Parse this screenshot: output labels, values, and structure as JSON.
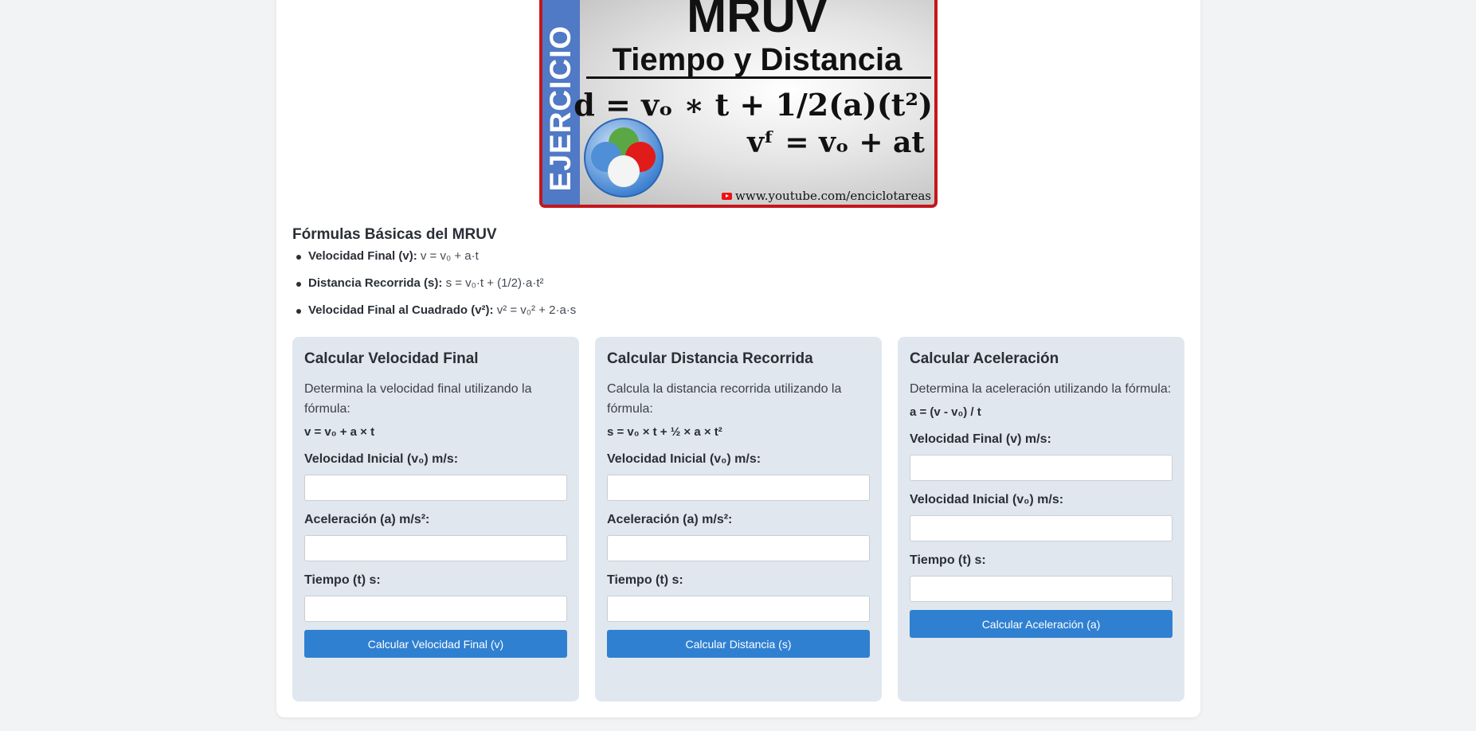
{
  "banner": {
    "side_text": "EJERCICIO",
    "title": "MRUV",
    "subtitle": "Tiempo y Distancia",
    "formula1": "d = vₒ ∗ t + 1/2(a)(t²)",
    "formula2": "vᶠ = vₒ + at",
    "url": "www.youtube.com/enciclotareas",
    "border_color": "#c4161c",
    "side_color": "#5079c6"
  },
  "formulas": {
    "title": "Fórmulas Básicas del MRUV",
    "items": [
      {
        "label": "Velocidad Final (v):",
        "formula": "v = v₀ + a·t"
      },
      {
        "label": "Distancia Recorrida (s):",
        "formula": "s = v₀·t + (1/2)·a·t²"
      },
      {
        "label": "Velocidad Final al Cuadrado (v²):",
        "formula": "v² = v₀² + 2·a·s"
      }
    ]
  },
  "calculators": {
    "velocity": {
      "title": "Calcular Velocidad Final",
      "description": "Determina la velocidad final utilizando la fórmula:",
      "formula": "v = v₀ + a × t",
      "fields": [
        {
          "label": "Velocidad Inicial (v₀) m/s:",
          "value": ""
        },
        {
          "label": "Aceleración (a) m/s²:",
          "value": ""
        },
        {
          "label": "Tiempo (t) s:",
          "value": ""
        }
      ],
      "button": "Calcular Velocidad Final (v)"
    },
    "distance": {
      "title": "Calcular Distancia Recorrida",
      "description": "Calcula la distancia recorrida utilizando la fórmula:",
      "formula": "s = v₀ × t + ½ × a × t²",
      "fields": [
        {
          "label": "Velocidad Inicial (v₀) m/s:",
          "value": ""
        },
        {
          "label": "Aceleración (a) m/s²:",
          "value": ""
        },
        {
          "label": "Tiempo (t) s:",
          "value": ""
        }
      ],
      "button": "Calcular Distancia (s)"
    },
    "acceleration": {
      "title": "Calcular Aceleración",
      "description": "Determina la aceleración utilizando la fórmula:",
      "formula": "a = (v - v₀) / t",
      "fields": [
        {
          "label": "Velocidad Final (v) m/s:",
          "value": ""
        },
        {
          "label": "Velocidad Inicial (v₀) m/s:",
          "value": ""
        },
        {
          "label": "Tiempo (t) s:",
          "value": ""
        }
      ],
      "button": "Calcular Aceleración (a)"
    }
  },
  "colors": {
    "page_bg": "#f2f3f4",
    "card_bg": "#e1e7ef",
    "button_bg": "#2f80d1"
  }
}
